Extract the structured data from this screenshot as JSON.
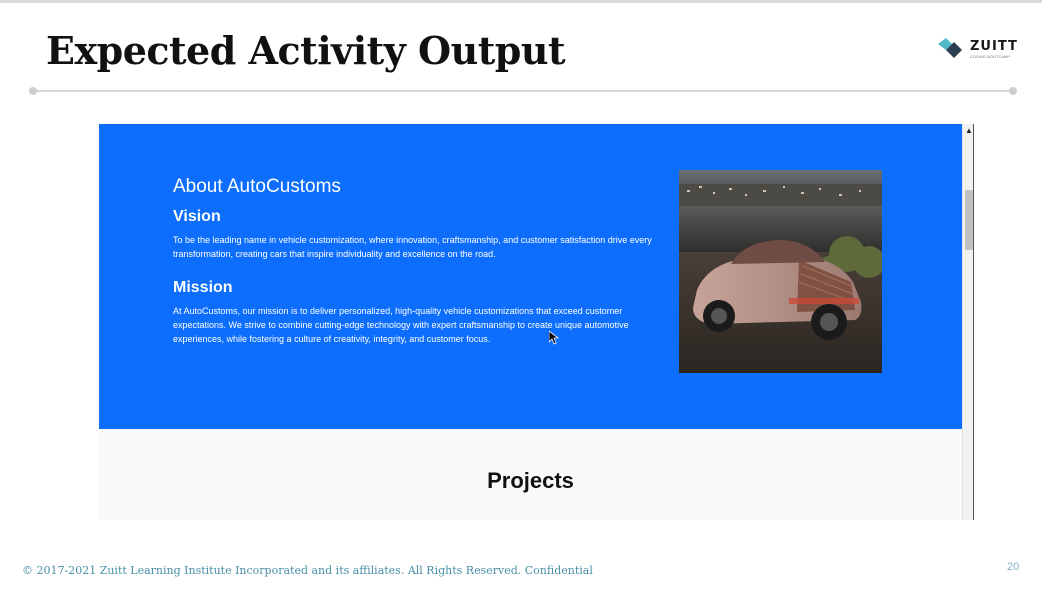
{
  "slide": {
    "title": "Expected Activity Output",
    "logo": {
      "name": "ZUITT",
      "tagline": "CODING BOOTCAMP"
    },
    "footer": "© 2017-2021 Zuitt Learning Institute Incorporated and its affiliates. All Rights Reserved. Confidential",
    "page_number": "20"
  },
  "webpage": {
    "hero": {
      "bg_color": "#0d6efd",
      "about_title": "About AutoCustoms",
      "vision_title": "Vision",
      "vision_text": "To be the leading name in vehicle customization, where innovation, craftsmanship, and customer satisfaction drive every transformation, creating cars that inspire individuality and excellence on the road.",
      "mission_title": "Mission",
      "mission_text": "At AutoCustoms, our mission is to deliver personalized, high-quality vehicle customizations that exceed customer expectations. We strive to combine cutting-edge technology with expert craftsmanship to create unique automotive experiences, while fostering a culture of creativity, integrity, and customer focus.",
      "image_icon": "car-photo"
    },
    "projects_title": "Projects"
  }
}
